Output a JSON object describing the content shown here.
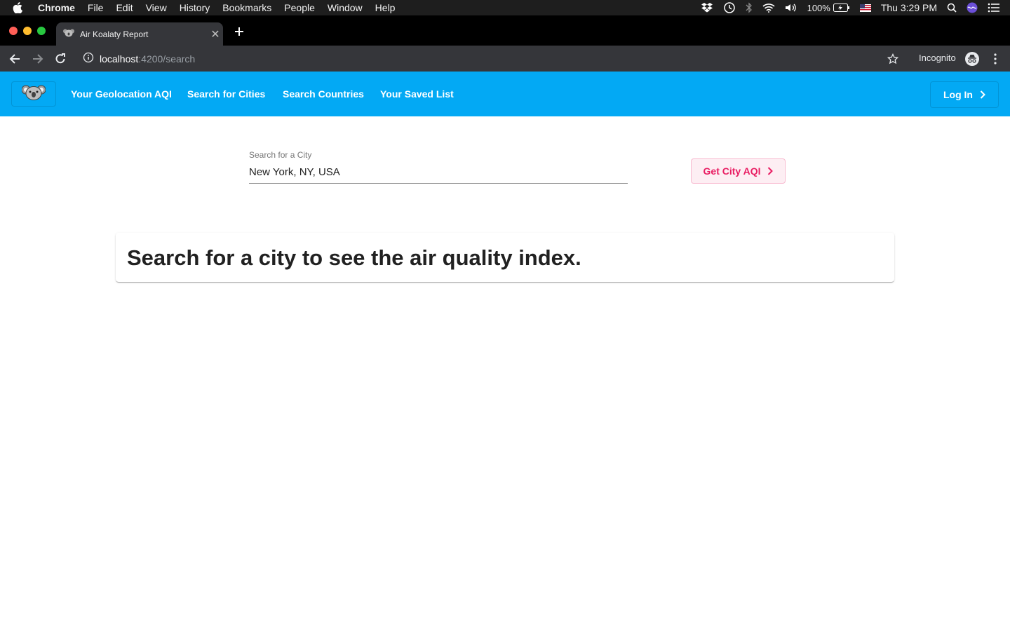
{
  "os_menubar": {
    "app": "Chrome",
    "items": [
      "File",
      "Edit",
      "View",
      "History",
      "Bookmarks",
      "People",
      "Window",
      "Help"
    ],
    "battery": "100%",
    "clock": "Thu 3:29 PM"
  },
  "browser": {
    "tab_title": "Air Koalaty Report",
    "url_host": "localhost",
    "url_path": ":4200/search",
    "incognito_label": "Incognito"
  },
  "app": {
    "nav": [
      "Your Geolocation AQI",
      "Search for Cities",
      "Search Countries",
      "Your Saved List"
    ],
    "login_label": "Log In"
  },
  "search": {
    "label": "Search for a City",
    "value": "New York, NY, USA",
    "button_label": "Get City AQI"
  },
  "card": {
    "message": "Search for a city to see the air quality index."
  },
  "colors": {
    "appbar": "#03a9f4",
    "accent": "#e91e63"
  }
}
